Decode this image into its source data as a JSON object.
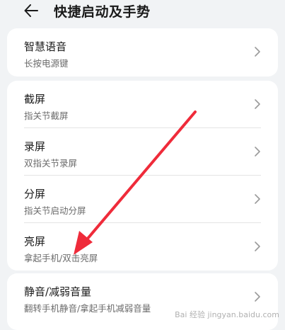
{
  "header": {
    "title": "快捷启动及手势",
    "back_icon": "back-arrow-icon"
  },
  "sections": [
    {
      "items": [
        {
          "title": "智慧语音",
          "subtitle": "长按电源键"
        }
      ]
    },
    {
      "items": [
        {
          "title": "截屏",
          "subtitle": "指关节截屏"
        },
        {
          "title": "录屏",
          "subtitle": "双指关节录屏"
        },
        {
          "title": "分屏",
          "subtitle": "指关节启动分屏"
        },
        {
          "title": "亮屏",
          "subtitle": "拿起手机/双击亮屏"
        }
      ]
    },
    {
      "items": [
        {
          "title": "静音/减弱音量",
          "subtitle": "翻转手机静音/拿起手机减弱音量"
        }
      ]
    }
  ],
  "annotation": {
    "color": "#ef2b3a"
  },
  "watermark": {
    "text": "Bai 经验 jingyan.baidu.com"
  },
  "colors": {
    "background": "#f1f3f5",
    "card": "#ffffff",
    "primary_text": "#1a1a1a",
    "secondary_text": "#6b6b6b"
  }
}
